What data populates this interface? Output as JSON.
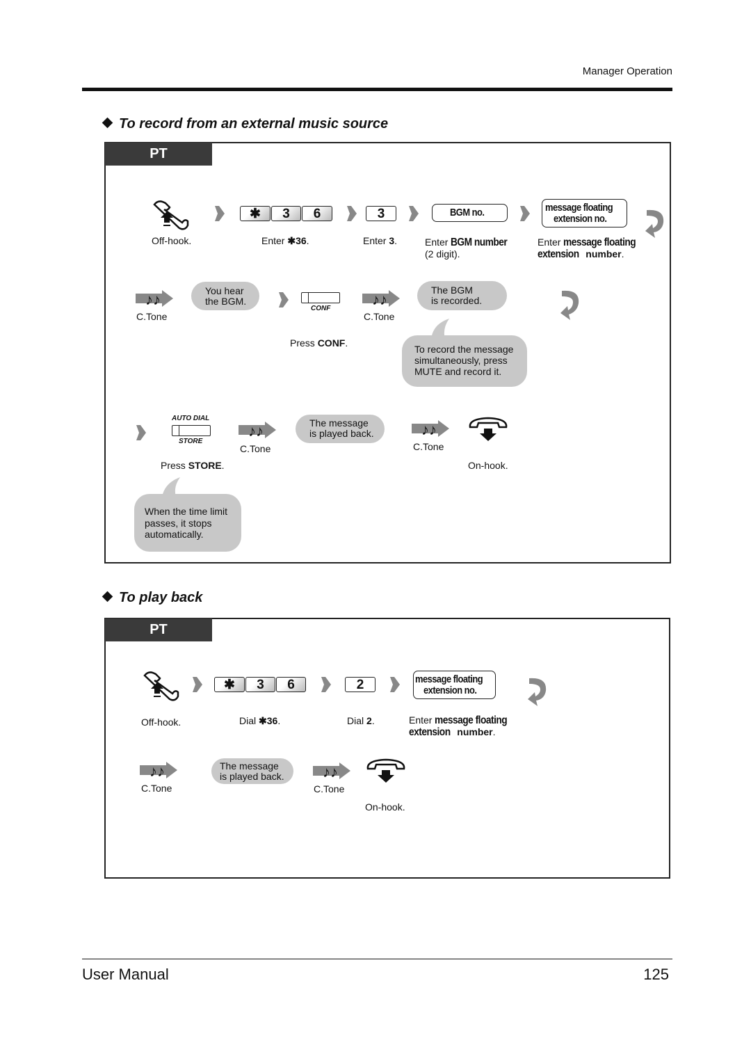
{
  "header": {
    "section": "Manager Operation"
  },
  "record": {
    "title": "To record from an external music source",
    "tab": "PT",
    "keys": {
      "star": "✱",
      "k3": "3",
      "k6": "6",
      "k3b": "3"
    },
    "bgm_box": "BGM no.",
    "msg_box": {
      "l1": "message floating",
      "l2": "extension no."
    },
    "labels": {
      "offhook": "Off-hook.",
      "enter36_pre": "Enter ",
      "enter36_b": "✱36",
      "dot": ".",
      "enter3_pre": "Enter ",
      "enter3_b": "3",
      "bgm_pre": "Enter ",
      "bgm_b": "BGM number",
      "bgm_l2": "(2 digit).",
      "msg_pre": "Enter ",
      "msg_b1": "message floating",
      "msg_b2": "extension",
      "msg_b3": "number",
      "ctone": "C.Tone",
      "press_conf_pre": "Press ",
      "press_conf_b": "CONF",
      "press_store_pre": "Press ",
      "press_store_b": "STORE",
      "onhook": "On-hook."
    },
    "bubbles": {
      "hear": {
        "l1": "You hear",
        "l2": "the BGM."
      },
      "recorded": {
        "l1": "The BGM",
        "l2": "is recorded."
      },
      "played": {
        "l1": "The message",
        "l2": "is played back."
      }
    },
    "conf_key": "CONF",
    "store_key": {
      "top": "AUTO DIAL",
      "bottom": "STORE"
    },
    "callout_mute": [
      "To record the message",
      "simultaneously, press",
      "MUTE and record it."
    ],
    "callout_time": [
      "When the time limit",
      "passes, it stops",
      "automatically."
    ]
  },
  "playback": {
    "title": "To play back",
    "tab": "PT",
    "keys": {
      "star": "✱",
      "k3": "3",
      "k6": "6",
      "k2": "2"
    },
    "msg_box": {
      "l1": "message floating",
      "l2": "extension no."
    },
    "labels": {
      "offhook": "Off-hook.",
      "dial36_pre": "Dial ",
      "dial36_b": "✱36",
      "dot": ".",
      "dial2_pre": "Dial ",
      "dial2_b": "2",
      "msg_pre": "Enter ",
      "msg_b1": "message floating",
      "msg_b2": "extension",
      "msg_b3": "number",
      "ctone": "C.Tone",
      "onhook": "On-hook."
    },
    "bubble": {
      "l1": "The message",
      "l2": "is played back."
    }
  },
  "footer": {
    "title": "User Manual",
    "page": "125"
  }
}
